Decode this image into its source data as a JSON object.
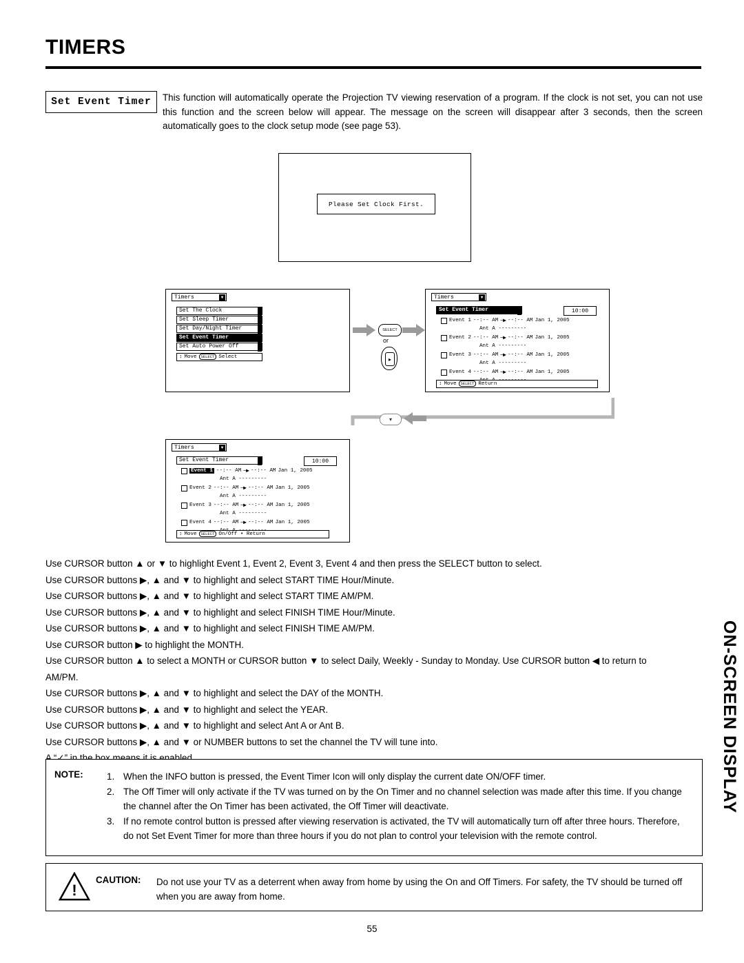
{
  "header": {
    "title": "TIMERS"
  },
  "intro": {
    "label": "Set Event Timer",
    "text": "This function will automatically operate the Projection TV viewing reservation of a program.  If the clock is not set, you can not use this function and the screen below will appear.  The message on the screen will disappear after 3 seconds, then the screen automatically goes to the clock setup mode (see page 53)."
  },
  "tv_screen": {
    "message": "Please Set Clock First."
  },
  "osd_menu": {
    "tab_label": "Timers",
    "items": [
      "Set The Clock",
      "Set Sleep Timer",
      "Set Day/Night Timer",
      "Set Event Timer",
      "Set Auto Power Off"
    ],
    "selected_item": "Set Event Timer",
    "footer_move": "Move",
    "footer_select_badge": "SELECT",
    "footer_select": "Select"
  },
  "osd_events_1": {
    "tab_label": "Timers",
    "header_row": "Set Event Timer",
    "clock": "10:00",
    "events": [
      {
        "name": "Event 1",
        "time": "--:-- AM",
        "arrow": "─▶",
        "time2": "--:-- AM",
        "date": "Jan 1, 2005",
        "ant": "Ant A ---------"
      },
      {
        "name": "Event 2",
        "time": "--:-- AM",
        "arrow": "─▶",
        "time2": "--:-- AM",
        "date": "Jan 1, 2005",
        "ant": "Ant A ---------"
      },
      {
        "name": "Event 3",
        "time": "--:-- AM",
        "arrow": "─▶",
        "time2": "--:-- AM",
        "date": "Jan 1, 2005",
        "ant": "Ant A ---------"
      },
      {
        "name": "Event 4",
        "time": "--:-- AM",
        "arrow": "─▶",
        "time2": "--:-- AM",
        "date": "Jan 1, 2005",
        "ant": "Ant A ---------"
      }
    ],
    "selected": "Set Event Timer",
    "footer_move": "Move",
    "footer_select_badge": "SELECT",
    "footer_action": "Return"
  },
  "osd_events_2": {
    "tab_label": "Timers",
    "header_row": "Set Event Timer",
    "clock": "10:00",
    "events": [
      {
        "name": "Event 1",
        "time": "--:-- AM",
        "arrow": "─▶",
        "time2": "--:-- AM",
        "date": "Jan 1, 2005",
        "ant": "Ant A ---------"
      },
      {
        "name": "Event 2",
        "time": "--:-- AM",
        "arrow": "─▶",
        "time2": "--:-- AM",
        "date": "Jan 1, 2005",
        "ant": "Ant A ---------"
      },
      {
        "name": "Event 3",
        "time": "--:-- AM",
        "arrow": "─▶",
        "time2": "--:-- AM",
        "date": "Jan 1, 2005",
        "ant": "Ant A ---------"
      },
      {
        "name": "Event 4",
        "time": "--:-- AM",
        "arrow": "─▶",
        "time2": "--:-- AM",
        "date": "Jan 1, 2005",
        "ant": "Ant A ---------"
      }
    ],
    "selected": "Event 1",
    "footer_move": "Move",
    "footer_select_badge": "SELECT",
    "footer_action": "On/Off • Return"
  },
  "remote": {
    "select_label": "SELECT",
    "or_label": "or",
    "dpad_glyph": "▸",
    "down_glyph": "▾"
  },
  "instructions": [
    "Use CURSOR button ▲ or ▼ to highlight Event 1, Event 2, Event 3, Event 4 and then press the SELECT button to select.",
    "Use CURSOR buttons ▶, ▲ and ▼ to highlight and select START TIME Hour/Minute.",
    "Use CURSOR buttons ▶, ▲ and ▼ to highlight and select START TIME AM/PM.",
    "Use CURSOR buttons ▶, ▲ and ▼ to highlight and select FINISH TIME Hour/Minute.",
    "Use CURSOR buttons ▶, ▲ and ▼ to highlight and select FINISH TIME AM/PM.",
    "Use CURSOR button ▶ to highlight the MONTH.",
    "Use CURSOR button ▲ to select a MONTH or CURSOR button ▼ to select Daily, Weekly - Sunday to Monday.  Use CURSOR button ◀ to return to AM/PM.",
    "Use CURSOR buttons ▶, ▲ and ▼ to highlight and select the DAY of the MONTH.",
    "Use CURSOR buttons ▶, ▲ and ▼ to highlight and select the YEAR.",
    "Use CURSOR buttons ▶, ▲ and ▼ to highlight and select Ant A or Ant B.",
    "Use CURSOR buttons ▶, ▲ and ▼ or NUMBER buttons to set the channel the TV will tune into.",
    "A “✓” in the box means it is enabled."
  ],
  "side_label": "ON-SCREEN DISPLAY",
  "note": {
    "label": "NOTE:",
    "items": [
      {
        "num": "1.",
        "text": "When the INFO button is pressed, the Event Timer Icon will only display the current date ON/OFF timer."
      },
      {
        "num": "2.",
        "text": "The Off Timer will only activate if the TV was turned on by the On Timer and no channel selection was made after this time.  If you change the channel after the On Timer has been activated, the Off Timer will deactivate."
      },
      {
        "num": "3.",
        "text": "If no remote control button is pressed after viewing reservation is activated, the TV will automatically turn off after three hours.  Therefore, do not Set Event Timer for more than three hours if you do not plan to control your television with the remote control."
      }
    ]
  },
  "caution": {
    "label": "CAUTION:",
    "text": "Do not use your TV as a deterrent when away from home by using the On and Off Timers.  For safety, the TV should be turned off when you are away from home.",
    "icon_glyph": "!"
  },
  "page_number": "55"
}
